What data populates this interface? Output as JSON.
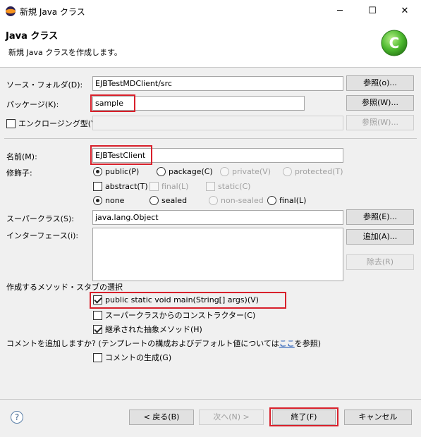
{
  "window": {
    "title": "新規 Java クラス",
    "minimize_icon": "─",
    "maximize_icon": "☐",
    "close_icon": "✕"
  },
  "banner": {
    "title": "Java クラス",
    "description": "新規 Java クラスを作成します。",
    "logo_letter": "C"
  },
  "source_folder": {
    "label": "ソース・フォルダ(D):",
    "value": "EJBTestMDClient/src",
    "browse": "参照(o)..."
  },
  "package": {
    "label": "パッケージ(K):",
    "value": "sample",
    "browse": "参照(W)..."
  },
  "enclosing": {
    "label": "エンクロージング型(Y):",
    "value": "",
    "browse": "参照(W)..."
  },
  "name": {
    "label": "名前(M):",
    "value": "EJBTestClient"
  },
  "modifiers": {
    "label": "修飾子:",
    "access": [
      "public(P)",
      "package(C)",
      "private(V)",
      "protected(T)"
    ],
    "flags": [
      "abstract(T)",
      "final(L)",
      "static(C)"
    ],
    "kind": [
      "none",
      "sealed",
      "non-sealed",
      "final(L)"
    ]
  },
  "superclass": {
    "label": "スーパークラス(S):",
    "value": "java.lang.Object",
    "browse": "参照(E)..."
  },
  "interfaces": {
    "label": "インターフェース(i):",
    "add": "追加(A)...",
    "remove": "除去(R)"
  },
  "stubs": {
    "label": "作成するメソッド・スタブの選択",
    "main": "public static void main(String[] args)(V)",
    "constructors": "スーパークラスからのコンストラクター(C)",
    "inherited": "継承された抽象メソッド(H)"
  },
  "comments": {
    "question_prefix": "コメントを追加しますか? (テンプレートの構成およびデフォルト値については",
    "link": "ここ",
    "question_suffix": "を参照)",
    "generate": "コメントの生成(G)"
  },
  "footer": {
    "help_icon": "?",
    "back": "< 戻る(B)",
    "next": "次へ(N) >",
    "finish": "終了(F)",
    "cancel": "キャンセル"
  }
}
